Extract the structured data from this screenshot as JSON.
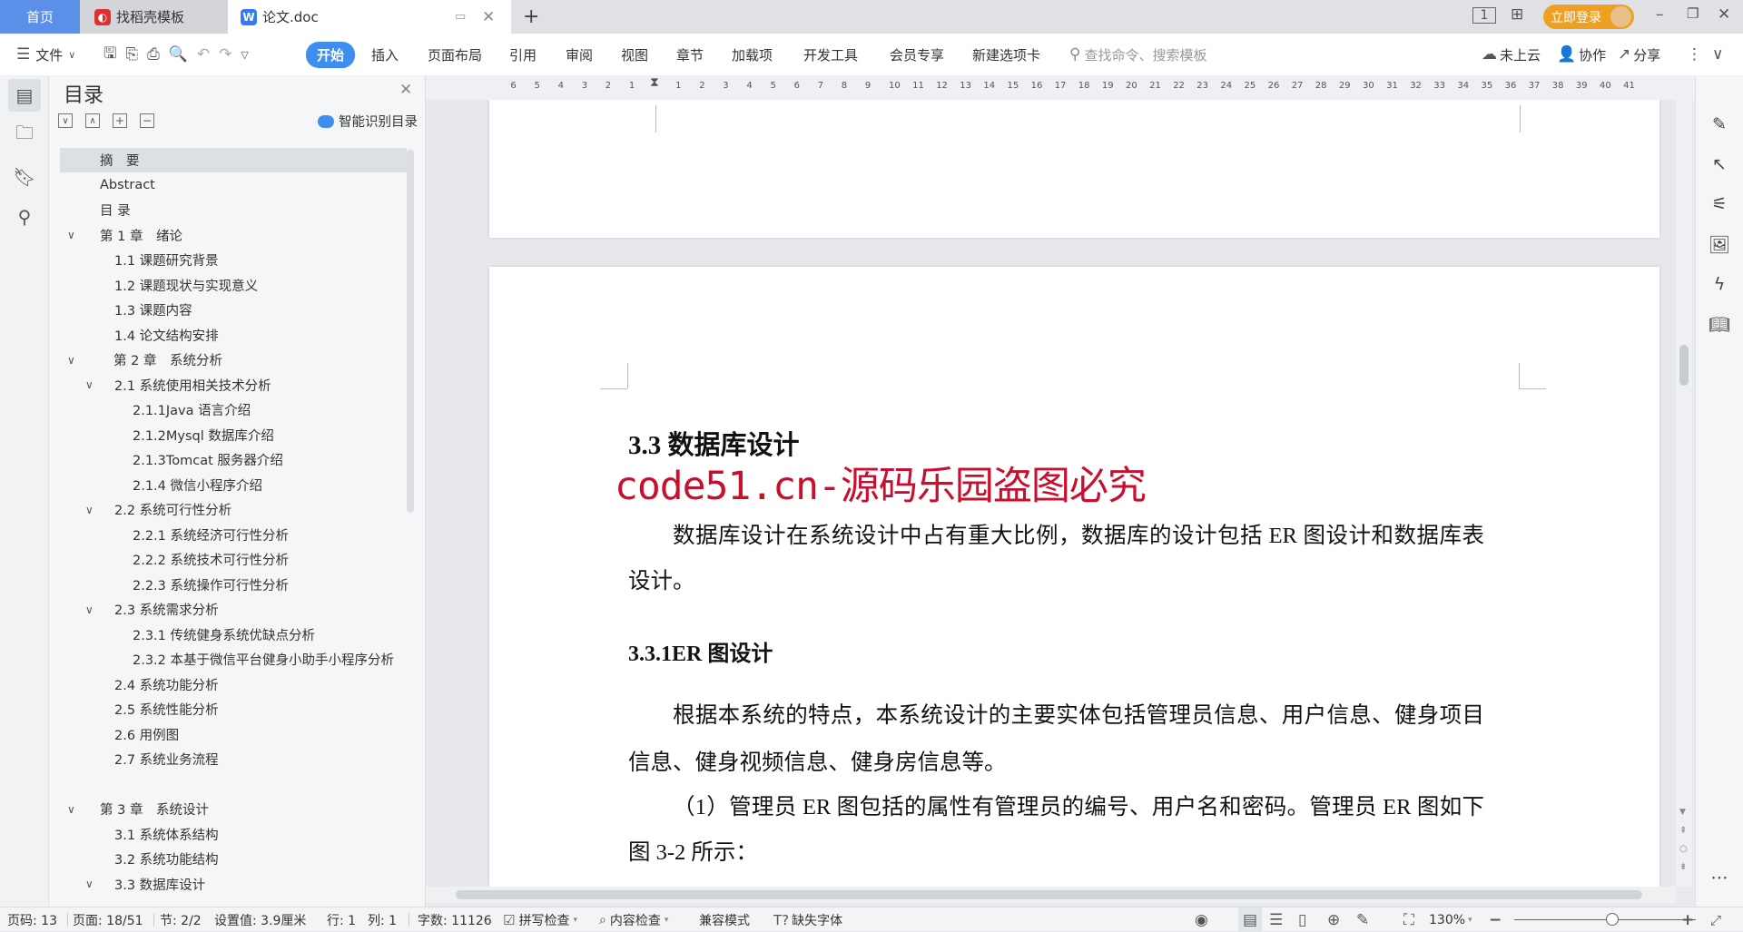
{
  "tabs": {
    "home": "首页",
    "templates": "找稻壳模板",
    "document": "论文.doc",
    "new_tab": "+"
  },
  "titlebar": {
    "login": "立即登录"
  },
  "toolbar": {
    "file": "文件",
    "menus": [
      "开始",
      "插入",
      "页面布局",
      "引用",
      "审阅",
      "视图",
      "章节",
      "加载项",
      "开发工具",
      "会员专享",
      "新建选项卡"
    ],
    "search_placeholder": "查找命令、搜索模板",
    "cloud": "未上云",
    "collab": "协作",
    "share": "分享"
  },
  "ruler": {
    "left": [
      "6",
      "5",
      "4",
      "3",
      "2",
      "1"
    ],
    "right": [
      "1",
      "2",
      "3",
      "4",
      "5",
      "6",
      "7",
      "8",
      "9",
      "10",
      "11",
      "12",
      "13",
      "14",
      "15",
      "16",
      "17",
      "18",
      "19",
      "20",
      "21",
      "22",
      "23",
      "24",
      "25",
      "26",
      "27",
      "28",
      "29",
      "30",
      "31",
      "32",
      "33",
      "34",
      "35",
      "36",
      "37",
      "38",
      "39",
      "40",
      "41"
    ]
  },
  "toc": {
    "title": "目录",
    "smart": "智能识别目录",
    "items": [
      {
        "label": "摘　要",
        "level": 0,
        "selected": true
      },
      {
        "label": "Abstract",
        "level": 0
      },
      {
        "label": "目  录",
        "level": 0
      },
      {
        "label": "第 1 章　绪论",
        "level": 0,
        "expanded": true
      },
      {
        "label": "1.1 课题研究背景",
        "level": 1
      },
      {
        "label": "1.2 课题现状与实现意义",
        "level": 1
      },
      {
        "label": "1.3 课题内容",
        "level": 1
      },
      {
        "label": "1.4 论文结构安排",
        "level": 1
      },
      {
        "label": "第 2 章　系统分析",
        "level": 0,
        "expanded": true,
        "extra_indent": true
      },
      {
        "label": "2.1 系统使用相关技术分析",
        "level": 1,
        "expanded": true
      },
      {
        "label": "2.1.1Java 语言介绍",
        "level": 2
      },
      {
        "label": "2.1.2Mysql 数据库介绍",
        "level": 2
      },
      {
        "label": "2.1.3Tomcat 服务器介绍",
        "level": 2
      },
      {
        "label": "2.1.4 微信小程序介绍",
        "level": 2
      },
      {
        "label": "2.2 系统可行性分析",
        "level": 1,
        "expanded": true
      },
      {
        "label": "2.2.1 系统经济可行性分析",
        "level": 2
      },
      {
        "label": "2.2.2 系统技术可行性分析",
        "level": 2
      },
      {
        "label": "2.2.3 系统操作可行性分析",
        "level": 2
      },
      {
        "label": "2.3 系统需求分析",
        "level": 1,
        "expanded": true
      },
      {
        "label": "2.3.1 传统健身系统优缺点分析",
        "level": 2
      },
      {
        "label": "2.3.2 本基于微信平台健身小助手小程序分析",
        "level": 2
      },
      {
        "label": "2.4 系统功能分析",
        "level": 1
      },
      {
        "label": "2.5 系统性能分析",
        "level": 1
      },
      {
        "label": "2.6 用例图",
        "level": 1
      },
      {
        "label": "2.7 系统业务流程",
        "level": 1
      },
      {
        "label": "",
        "level": 1
      },
      {
        "label": "第 3 章　系统设计",
        "level": 0,
        "expanded": true
      },
      {
        "label": "3.1 系统体系结构",
        "level": 1
      },
      {
        "label": "3.2 系统功能结构",
        "level": 1
      },
      {
        "label": "3.3 数据库设计",
        "level": 1,
        "expanded": true
      }
    ]
  },
  "document": {
    "heading": "3.3 数据库设计",
    "watermark": "code51.cn-源码乐园盗图必究",
    "para1": "数据库设计在系统设计中占有重大比例，数据库的设计包括 ER 图设计和数据库表设计。",
    "subheading": "3.3.1ER 图设计",
    "para2": "根据本系统的特点，本系统设计的主要实体包括管理员信息、用户信息、健身项目信息、健身视频信息、健身房信息等。",
    "para3": "（1）管理员 ER 图包括的属性有管理员的编号、用户名和密码。管理员 ER 图如下图 3-2 所示："
  },
  "status": {
    "page_num": "页码: 13",
    "pages": "页面: 18/51",
    "section": "节: 2/2",
    "setting": "设置值: 3.9厘米",
    "row": "行: 1",
    "col": "列: 1",
    "words": "字数: 11126",
    "spell": "拼写检查",
    "content": "内容检查",
    "compat": "兼容模式",
    "missing_font": "缺失字体",
    "zoom": "130%",
    "zoom_percent": 130
  },
  "colors": {
    "accent": "#3d8ef0",
    "home_tab": "#5b8fe8",
    "login": "#f0a020",
    "watermark": "#c8102e"
  }
}
